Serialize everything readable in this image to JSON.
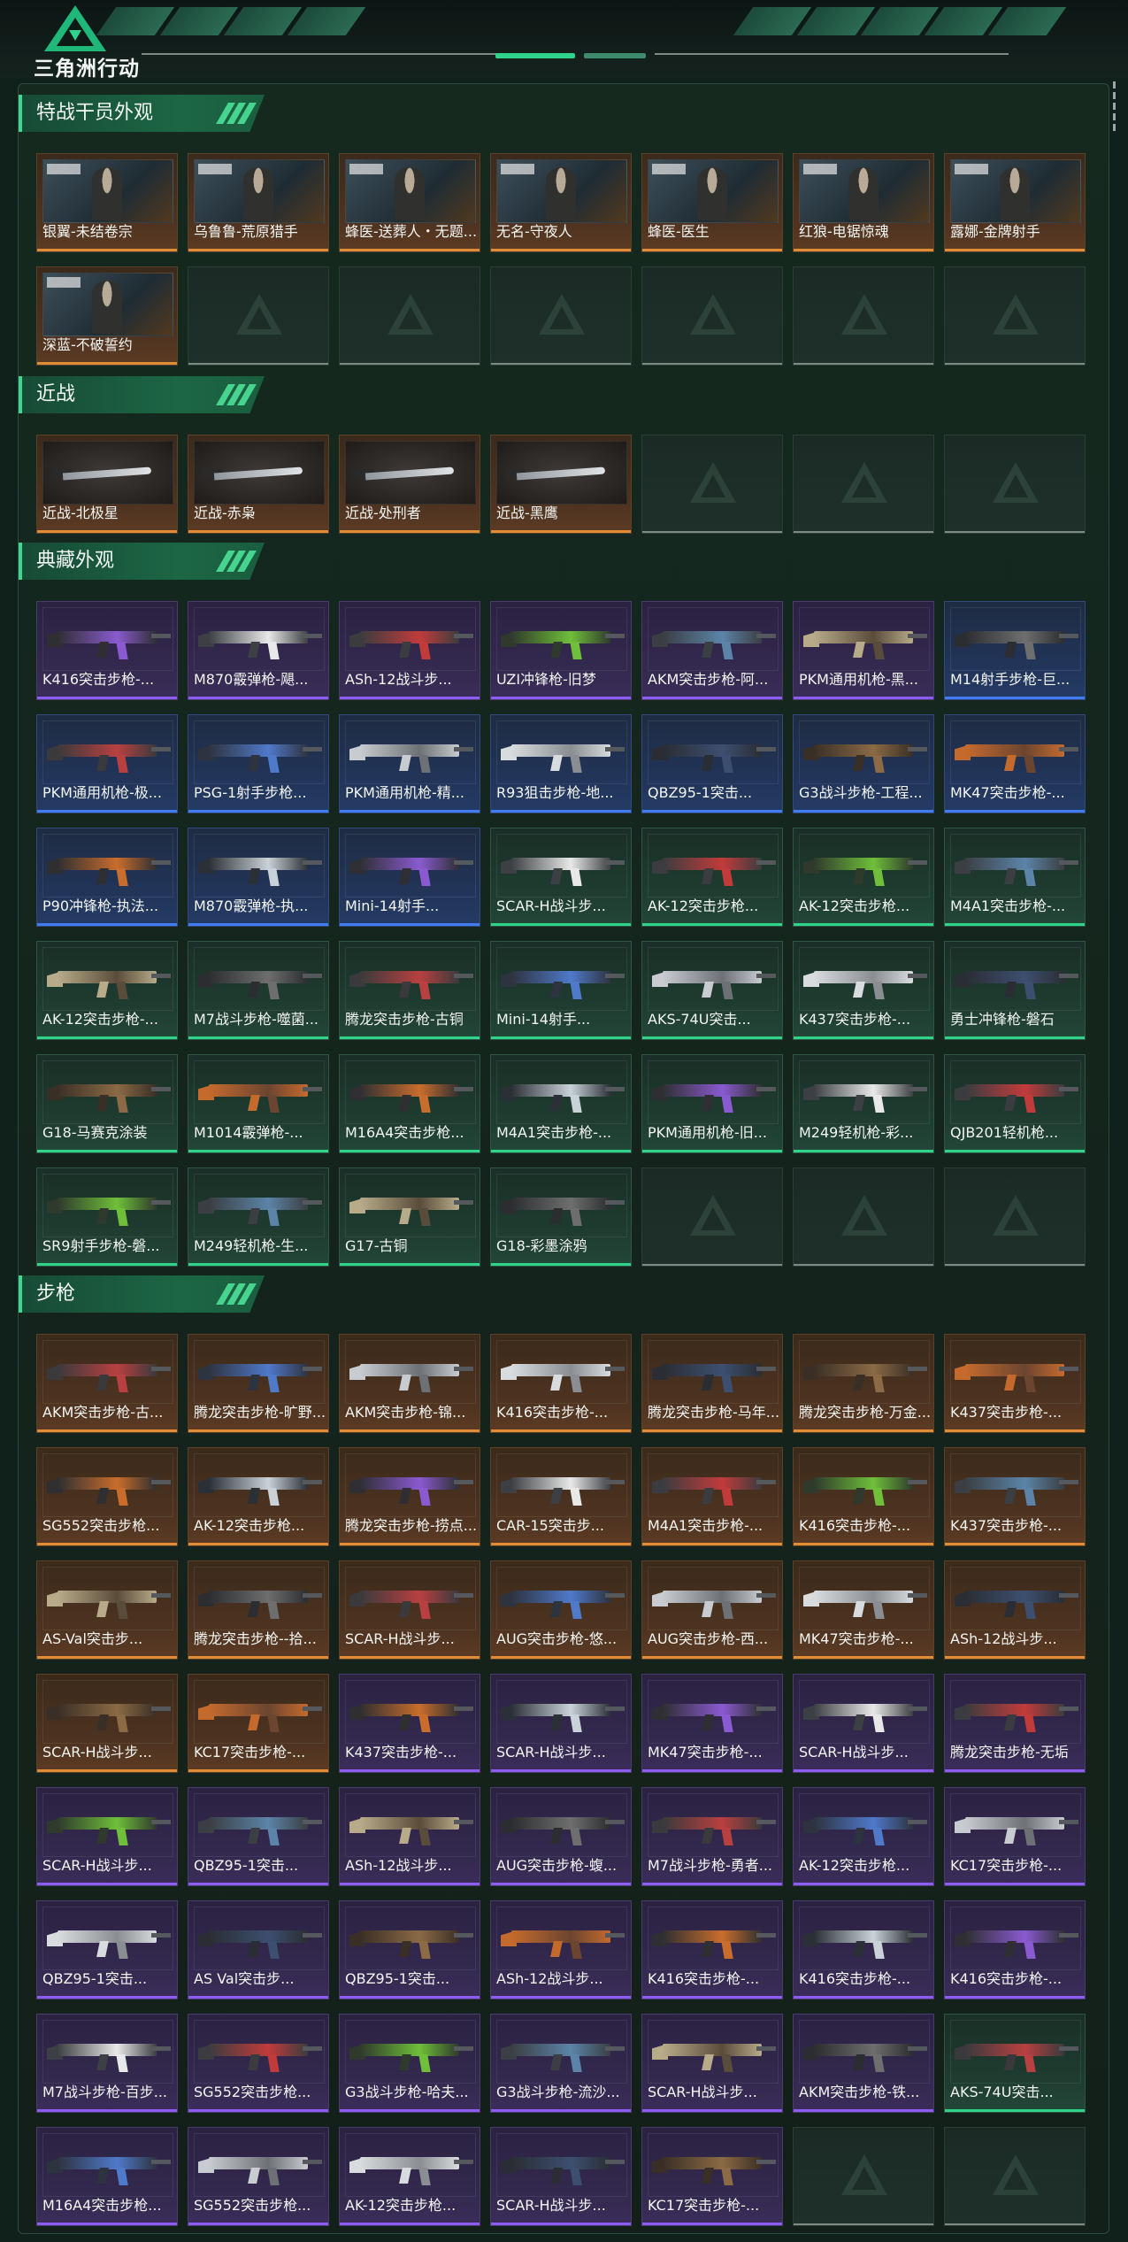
{
  "app": {
    "title": "三角洲行动"
  },
  "colors": {
    "accent": "#2fd38a",
    "rarity_gold": "#e08b35",
    "rarity_purple": "#8d5cf0",
    "rarity_blue": "#3f7df0",
    "rarity_green": "#2fd38a"
  },
  "sections": [
    {
      "title": "特战干员外观",
      "kind": "operator",
      "items": [
        {
          "label": "银翼-未结卷宗",
          "rarity": "gold"
        },
        {
          "label": "乌鲁鲁-荒原猎手",
          "rarity": "gold"
        },
        {
          "label": "蜂医-送葬人・无题...",
          "rarity": "gold"
        },
        {
          "label": "无名-守夜人",
          "rarity": "gold"
        },
        {
          "label": "蜂医-医生",
          "rarity": "gold"
        },
        {
          "label": "红狼-电锯惊魂",
          "rarity": "gold"
        },
        {
          "label": "露娜-金牌射手",
          "rarity": "gold"
        },
        {
          "label": "深蓝-不破誓约",
          "rarity": "gold"
        },
        {
          "label": "",
          "rarity": "empty"
        },
        {
          "label": "",
          "rarity": "empty"
        },
        {
          "label": "",
          "rarity": "empty"
        },
        {
          "label": "",
          "rarity": "empty"
        },
        {
          "label": "",
          "rarity": "empty"
        },
        {
          "label": "",
          "rarity": "empty"
        }
      ]
    },
    {
      "title": "近战",
      "kind": "knife",
      "items": [
        {
          "label": "近战-北极星",
          "rarity": "gold"
        },
        {
          "label": "近战-赤枭",
          "rarity": "gold"
        },
        {
          "label": "近战-处刑者",
          "rarity": "gold"
        },
        {
          "label": "近战-黑鹰",
          "rarity": "gold"
        },
        {
          "label": "",
          "rarity": "empty"
        },
        {
          "label": "",
          "rarity": "empty"
        },
        {
          "label": "",
          "rarity": "empty"
        }
      ]
    },
    {
      "title": "典藏外观",
      "kind": "gun",
      "items": [
        {
          "label": "K416突击步枪-...",
          "rarity": "purple"
        },
        {
          "label": "M870霰弹枪-飓...",
          "rarity": "purple"
        },
        {
          "label": "ASh-12战斗步...",
          "rarity": "purple"
        },
        {
          "label": "UZI冲锋枪-旧梦",
          "rarity": "purple"
        },
        {
          "label": "AKM突击步枪-阿...",
          "rarity": "purple"
        },
        {
          "label": "PKM通用机枪-黑...",
          "rarity": "purple"
        },
        {
          "label": "M14射手步枪-巨...",
          "rarity": "blue"
        },
        {
          "label": "PKM通用机枪-极...",
          "rarity": "blue"
        },
        {
          "label": "PSG-1射手步枪...",
          "rarity": "blue"
        },
        {
          "label": "PKM通用机枪-精...",
          "rarity": "blue"
        },
        {
          "label": "R93狙击步枪-地...",
          "rarity": "blue"
        },
        {
          "label": "QBZ95-1突击...",
          "rarity": "blue"
        },
        {
          "label": "G3战斗步枪-工程...",
          "rarity": "blue"
        },
        {
          "label": "MK47突击步枪-...",
          "rarity": "blue"
        },
        {
          "label": "P90冲锋枪-执法...",
          "rarity": "blue"
        },
        {
          "label": "M870霰弹枪-执...",
          "rarity": "blue"
        },
        {
          "label": "Mini-14射手...",
          "rarity": "blue"
        },
        {
          "label": "SCAR-H战斗步...",
          "rarity": "green"
        },
        {
          "label": "AK-12突击步枪...",
          "rarity": "green"
        },
        {
          "label": "AK-12突击步枪...",
          "rarity": "green"
        },
        {
          "label": "M4A1突击步枪-...",
          "rarity": "green"
        },
        {
          "label": "AK-12突击步枪-...",
          "rarity": "green"
        },
        {
          "label": "M7战斗步枪-噬菌...",
          "rarity": "green"
        },
        {
          "label": "腾龙突击步枪-古铜",
          "rarity": "green"
        },
        {
          "label": "Mini-14射手...",
          "rarity": "green"
        },
        {
          "label": "AKS-74U突击...",
          "rarity": "green"
        },
        {
          "label": "K437突击步枪-...",
          "rarity": "green"
        },
        {
          "label": "勇士冲锋枪-磐石",
          "rarity": "green"
        },
        {
          "label": "G18-马赛克涂装",
          "rarity": "green"
        },
        {
          "label": "M1014霰弹枪-...",
          "rarity": "green"
        },
        {
          "label": "M16A4突击步枪...",
          "rarity": "green"
        },
        {
          "label": "M4A1突击步枪-...",
          "rarity": "green"
        },
        {
          "label": "PKM通用机枪-旧...",
          "rarity": "green"
        },
        {
          "label": "M249轻机枪-彩...",
          "rarity": "green"
        },
        {
          "label": "QJB201轻机枪...",
          "rarity": "green"
        },
        {
          "label": "SR9射手步枪-磐...",
          "rarity": "green"
        },
        {
          "label": "M249轻机枪-生...",
          "rarity": "green"
        },
        {
          "label": "G17-古铜",
          "rarity": "green"
        },
        {
          "label": "G18-彩墨涂鸦",
          "rarity": "green"
        },
        {
          "label": "",
          "rarity": "empty"
        },
        {
          "label": "",
          "rarity": "empty"
        },
        {
          "label": "",
          "rarity": "empty"
        }
      ]
    },
    {
      "title": "步枪",
      "kind": "gun",
      "items": [
        {
          "label": "AKM突击步枪-古...",
          "rarity": "gold"
        },
        {
          "label": "腾龙突击步枪-旷野...",
          "rarity": "gold"
        },
        {
          "label": "AKM突击步枪-锦...",
          "rarity": "gold"
        },
        {
          "label": "K416突击步枪-...",
          "rarity": "gold"
        },
        {
          "label": "腾龙突击步枪-马年...",
          "rarity": "gold"
        },
        {
          "label": "腾龙突击步枪-万金...",
          "rarity": "gold"
        },
        {
          "label": "K437突击步枪-...",
          "rarity": "gold"
        },
        {
          "label": "SG552突击步枪...",
          "rarity": "gold"
        },
        {
          "label": "AK-12突击步枪...",
          "rarity": "gold"
        },
        {
          "label": "腾龙突击步枪-捞点...",
          "rarity": "gold"
        },
        {
          "label": "CAR-15突击步...",
          "rarity": "gold"
        },
        {
          "label": "M4A1突击步枪-...",
          "rarity": "gold"
        },
        {
          "label": "K416突击步枪-...",
          "rarity": "gold"
        },
        {
          "label": "K437突击步枪-...",
          "rarity": "gold"
        },
        {
          "label": "AS-Val突击步...",
          "rarity": "gold"
        },
        {
          "label": "腾龙突击步枪--拾...",
          "rarity": "gold"
        },
        {
          "label": "SCAR-H战斗步...",
          "rarity": "gold"
        },
        {
          "label": "AUG突击步枪-悠...",
          "rarity": "gold"
        },
        {
          "label": "AUG突击步枪-西...",
          "rarity": "gold"
        },
        {
          "label": "MK47突击步枪-...",
          "rarity": "gold"
        },
        {
          "label": "ASh-12战斗步...",
          "rarity": "gold"
        },
        {
          "label": "SCAR-H战斗步...",
          "rarity": "gold"
        },
        {
          "label": "KC17突击步枪-...",
          "rarity": "gold"
        },
        {
          "label": "K437突击步枪-...",
          "rarity": "purple"
        },
        {
          "label": "SCAR-H战斗步...",
          "rarity": "purple"
        },
        {
          "label": "MK47突击步枪-...",
          "rarity": "purple"
        },
        {
          "label": "SCAR-H战斗步...",
          "rarity": "purple"
        },
        {
          "label": "腾龙突击步枪-无垢",
          "rarity": "purple"
        },
        {
          "label": "SCAR-H战斗步...",
          "rarity": "purple"
        },
        {
          "label": "QBZ95-1突击...",
          "rarity": "purple"
        },
        {
          "label": "ASh-12战斗步...",
          "rarity": "purple"
        },
        {
          "label": "AUG突击步枪-蝮...",
          "rarity": "purple"
        },
        {
          "label": "M7战斗步枪-勇者...",
          "rarity": "purple"
        },
        {
          "label": "AK-12突击步枪...",
          "rarity": "purple"
        },
        {
          "label": "KC17突击步枪-...",
          "rarity": "purple"
        },
        {
          "label": "QBZ95-1突击...",
          "rarity": "purple"
        },
        {
          "label": "AS Val突击步...",
          "rarity": "purple"
        },
        {
          "label": "QBZ95-1突击...",
          "rarity": "purple"
        },
        {
          "label": "ASh-12战斗步...",
          "rarity": "purple"
        },
        {
          "label": "K416突击步枪-...",
          "rarity": "purple"
        },
        {
          "label": "K416突击步枪-...",
          "rarity": "purple"
        },
        {
          "label": "K416突击步枪-...",
          "rarity": "purple"
        },
        {
          "label": "M7战斗步枪-百步...",
          "rarity": "purple"
        },
        {
          "label": "SG552突击步枪...",
          "rarity": "purple"
        },
        {
          "label": "G3战斗步枪-哈夫...",
          "rarity": "purple"
        },
        {
          "label": "G3战斗步枪-流沙...",
          "rarity": "purple"
        },
        {
          "label": "SCAR-H战斗步...",
          "rarity": "purple"
        },
        {
          "label": "AKM突击步枪-铁...",
          "rarity": "purple"
        },
        {
          "label": "AKS-74U突击...",
          "rarity": "green"
        },
        {
          "label": "M16A4突击步枪...",
          "rarity": "purple"
        },
        {
          "label": "SG552突击步枪...",
          "rarity": "purple"
        },
        {
          "label": "AK-12突击步枪...",
          "rarity": "purple"
        },
        {
          "label": "SCAR-H战斗步...",
          "rarity": "purple"
        },
        {
          "label": "KC17突击步枪-...",
          "rarity": "purple"
        },
        {
          "label": "",
          "rarity": "empty"
        },
        {
          "label": "",
          "rarity": "empty"
        }
      ]
    }
  ]
}
